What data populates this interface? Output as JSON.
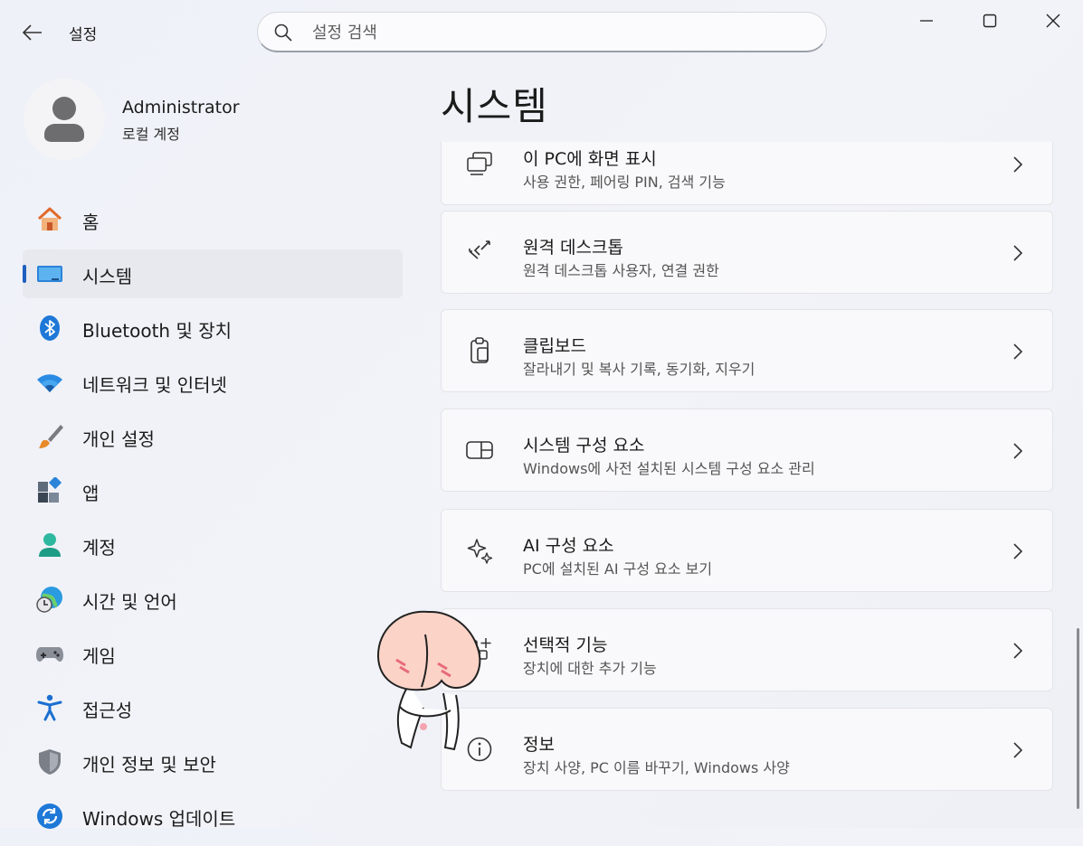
{
  "window": {
    "app_title": "설정",
    "search_placeholder": "설정 검색"
  },
  "profile": {
    "name": "Administrator",
    "account_type": "로컬 계정"
  },
  "nav": {
    "items": [
      {
        "label": "홈",
        "icon": "home-icon"
      },
      {
        "label": "시스템",
        "icon": "system-icon",
        "active": true
      },
      {
        "label": "Bluetooth 및 장치",
        "icon": "bluetooth-icon"
      },
      {
        "label": "네트워크 및 인터넷",
        "icon": "wifi-icon"
      },
      {
        "label": "개인 설정",
        "icon": "brush-icon"
      },
      {
        "label": "앱",
        "icon": "apps-icon"
      },
      {
        "label": "계정",
        "icon": "account-icon"
      },
      {
        "label": "시간 및 언어",
        "icon": "globe-clock-icon"
      },
      {
        "label": "게임",
        "icon": "gamepad-icon"
      },
      {
        "label": "접근성",
        "icon": "accessibility-icon"
      },
      {
        "label": "개인 정보 및 보안",
        "icon": "shield-icon"
      },
      {
        "label": "Windows 업데이트",
        "icon": "update-icon"
      }
    ]
  },
  "main": {
    "title": "시스템",
    "cards": [
      {
        "title": "이 PC에 화면 표시",
        "desc": "사용 권한, 페어링 PIN, 검색 기능",
        "icon": "project-pc-icon"
      },
      {
        "title": "원격 데스크톱",
        "desc": "원격 데스크톱 사용자, 연결 권한",
        "icon": "remote-desktop-icon"
      },
      {
        "title": "클립보드",
        "desc": "잘라내기 및 복사 기록, 동기화, 지우기",
        "icon": "clipboard-icon"
      },
      {
        "title": "시스템 구성 요소",
        "desc": "Windows에 사전 설치된 시스템 구성 요소 관리",
        "icon": "system-components-icon"
      },
      {
        "title": "AI 구성 요소",
        "desc": "PC에 설치된 AI 구성 요소 보기",
        "icon": "sparkle-icon"
      },
      {
        "title": "선택적 기능",
        "desc": "장치에 대한 추가 기능",
        "icon": "optional-features-icon"
      },
      {
        "title": "정보",
        "desc": "장치 사양, PC 이름 바꾸기, Windows 사양",
        "icon": "info-icon"
      }
    ]
  },
  "colors": {
    "accent": "#1f5fbf",
    "background": "#eff1f7",
    "card": "#f9f9fb"
  }
}
